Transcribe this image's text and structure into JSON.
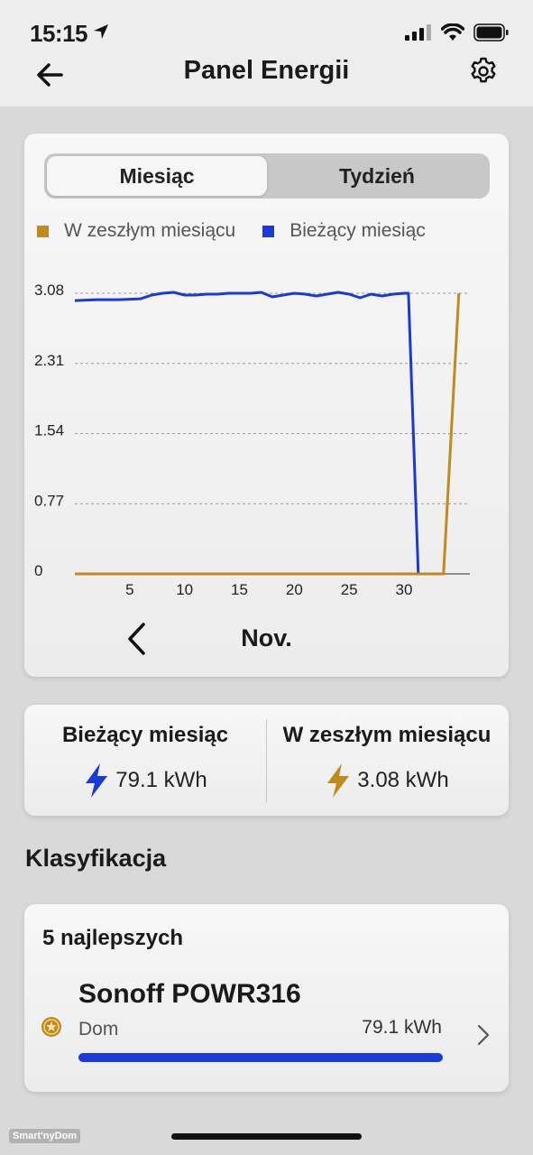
{
  "status": {
    "time": "15:15"
  },
  "header": {
    "title": "Panel Energii"
  },
  "tabs": [
    {
      "label": "Miesiąc",
      "active": true
    },
    {
      "label": "Tydzień",
      "active": false
    }
  ],
  "legend": [
    {
      "label": "W zeszłym miesiącu",
      "color": "#c08a1e"
    },
    {
      "label": "Bieżący miesiąc",
      "color": "#1a39d6"
    }
  ],
  "chart_data": {
    "type": "line",
    "x_ticks": [
      "5",
      "10",
      "15",
      "20",
      "25",
      "30"
    ],
    "y_ticks": [
      "0",
      "0.77",
      "1.54",
      "2.31",
      "3.08"
    ],
    "ylim": [
      0,
      3.08
    ],
    "xlim": [
      0,
      36
    ],
    "grid": true,
    "series": [
      {
        "name": "Bieżący miesiąc",
        "color": "#1a39d6",
        "points": [
          [
            0,
            3.0
          ],
          [
            2,
            3.01
          ],
          [
            4,
            3.01
          ],
          [
            6,
            3.02
          ],
          [
            7,
            3.06
          ],
          [
            8,
            3.08
          ],
          [
            9,
            3.09
          ],
          [
            10,
            3.06
          ],
          [
            11,
            3.06
          ],
          [
            12,
            3.07
          ],
          [
            13,
            3.07
          ],
          [
            14,
            3.08
          ],
          [
            15,
            3.08
          ],
          [
            16,
            3.08
          ],
          [
            17,
            3.09
          ],
          [
            18,
            3.04
          ],
          [
            20,
            3.08
          ],
          [
            21,
            3.07
          ],
          [
            22,
            3.05
          ],
          [
            23,
            3.07
          ],
          [
            24,
            3.09
          ],
          [
            25,
            3.07
          ],
          [
            26,
            3.03
          ],
          [
            27,
            3.07
          ],
          [
            28,
            3.05
          ],
          [
            29,
            3.07
          ],
          [
            30,
            3.08
          ],
          [
            30.4,
            3.08
          ],
          [
            31.3,
            0
          ]
        ]
      },
      {
        "name": "W zeszłym miesiącu",
        "color": "#c08a1e",
        "points": [
          [
            0,
            0
          ],
          [
            33.6,
            0
          ],
          [
            35,
            3.08
          ]
        ]
      }
    ]
  },
  "month_nav": {
    "label": "Nov."
  },
  "summary": {
    "current": {
      "title": "Bieżący miesiąc",
      "value": "79.1 kWh",
      "icon_color": "#1a39d6"
    },
    "previous": {
      "title": "W zeszłym miesiącu",
      "value": "3.08 kWh",
      "icon_color": "#c08a1e"
    }
  },
  "ranking": {
    "section_title": "Klasyfikacja",
    "subtitle": "5 najlepszych",
    "items": [
      {
        "name": "Sonoff POWR316",
        "room": "Dom",
        "value": "79.1 kWh",
        "share": 1.0
      }
    ]
  },
  "watermark": "Smart'nyDom"
}
